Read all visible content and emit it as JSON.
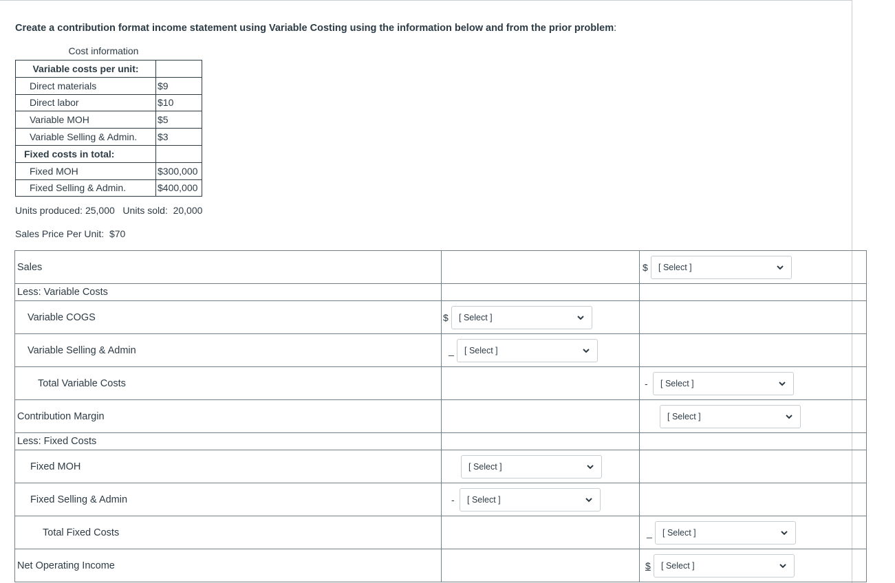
{
  "prompt": {
    "bold": "Create a contribution format income statement using Variable Costing using the information below and from the prior problem",
    "rest": ":"
  },
  "cost_table": {
    "caption": "Cost information",
    "rows": [
      {
        "label": "Variable costs per unit:",
        "value": "",
        "type": "head"
      },
      {
        "label": "Direct materials",
        "value": "$9",
        "type": "sub"
      },
      {
        "label": "Direct labor",
        "value": "$10",
        "type": "sub"
      },
      {
        "label": "Variable MOH",
        "value": "$5",
        "type": "sub"
      },
      {
        "label": "Variable Selling & Admin.",
        "value": "$3",
        "type": "sub"
      },
      {
        "label": "Fixed costs in total:",
        "value": "",
        "type": "head2"
      },
      {
        "label": "Fixed MOH",
        "value": "$300,000",
        "type": "sub"
      },
      {
        "label": "Fixed Selling & Admin.",
        "value": "$400,000",
        "type": "sub"
      }
    ]
  },
  "units_line": "Units produced: 25,000   Units sold:  20,000",
  "price_line": "Sales Price Per Unit:  $70",
  "statement": {
    "select_placeholder": "[ Select ]",
    "rows": [
      {
        "label": "Sales",
        "col2": null,
        "col3": {
          "prefix": "$"
        }
      },
      {
        "label": "Less: Variable Costs",
        "col2": null,
        "col3": null
      },
      {
        "label": "Variable COGS",
        "col2": {
          "prefix": "$"
        },
        "col3": null
      },
      {
        "label": "Variable Selling & Admin",
        "col2": {
          "prefix": "_"
        },
        "col3": null
      },
      {
        "label": "Total Variable Costs",
        "col2": null,
        "col3": {
          "prefix": "-"
        }
      },
      {
        "label": "Contribution Margin",
        "col2": null,
        "col3": {
          "prefix": ""
        }
      },
      {
        "label": "Less:  Fixed Costs",
        "col2": null,
        "col3": null
      },
      {
        "label": "Fixed MOH",
        "col2": {
          "prefix": ""
        },
        "col3": null
      },
      {
        "label": "Fixed Selling & Admin",
        "col2": {
          "prefix": "-"
        },
        "col3": null
      },
      {
        "label": "Total Fixed Costs",
        "col2": null,
        "col3": {
          "prefix": "_"
        }
      },
      {
        "label": "Net Operating Income",
        "col2": null,
        "col3": {
          "prefix": "$"
        }
      }
    ]
  }
}
